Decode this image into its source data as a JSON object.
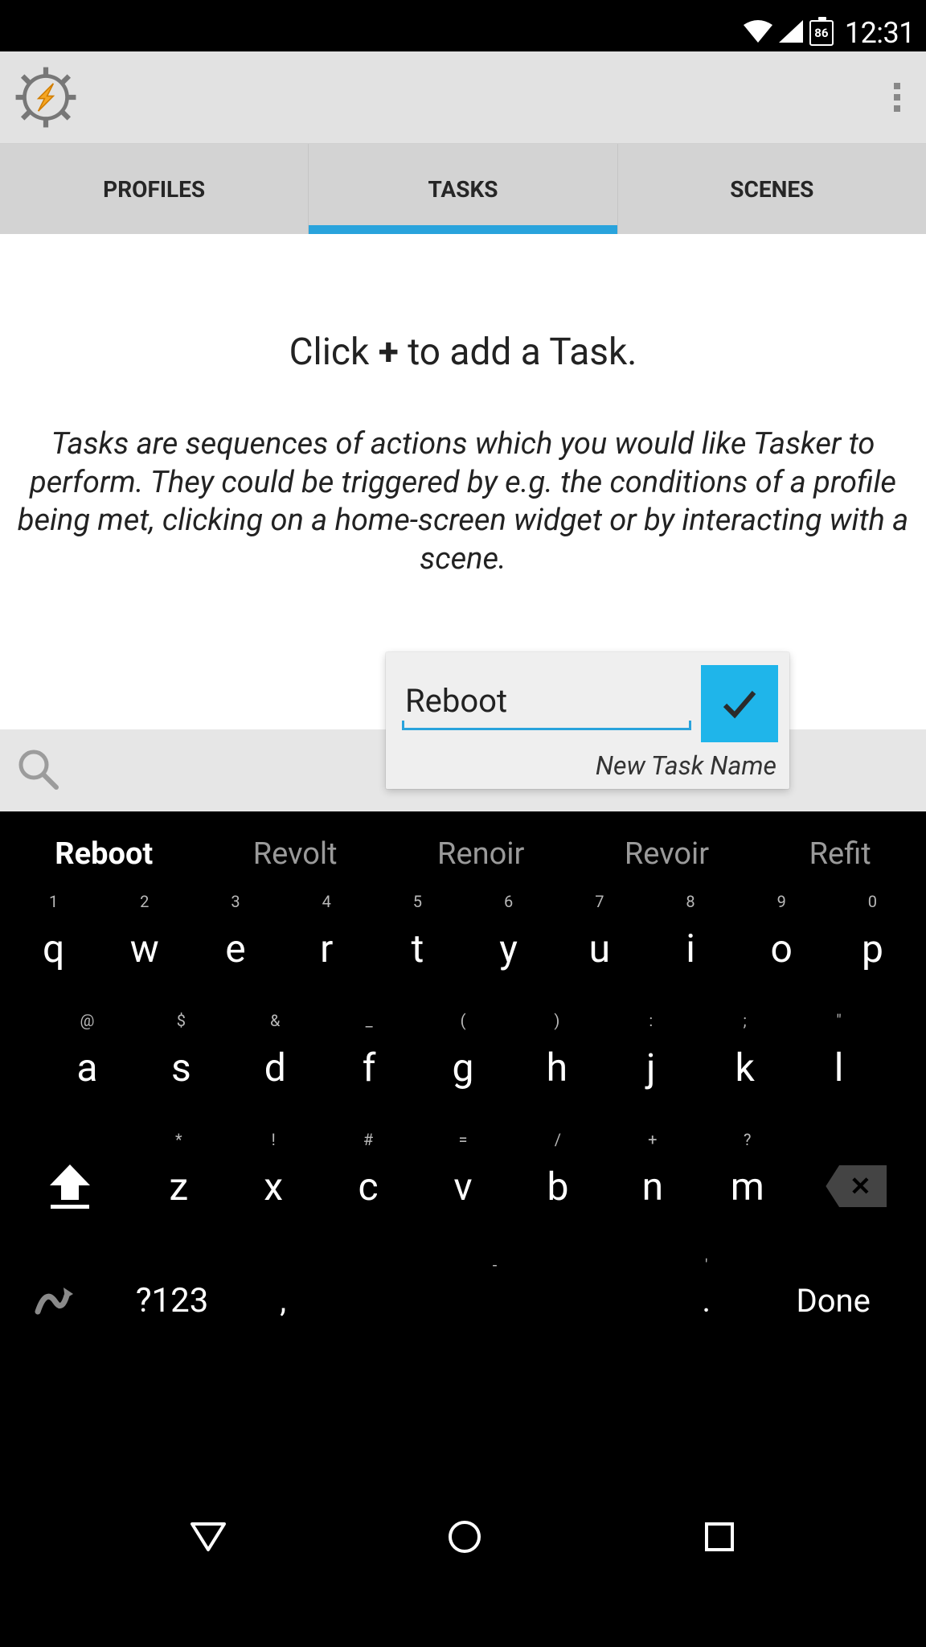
{
  "status": {
    "battery": "86",
    "clock": "12:31"
  },
  "tabs": [
    "PROFILES",
    "TASKS",
    "SCENES"
  ],
  "active_tab": 1,
  "content": {
    "headline_pre": "Click ",
    "headline_plus": "+",
    "headline_post": " to add a Task.",
    "body": "Tasks are sequences of actions which you would like Tasker to perform. They could be triggered by e.g. the conditions of a profile being met, clicking on a home-screen widget or by interacting with a scene."
  },
  "popup": {
    "value": "Reboot",
    "caption": "New Task Name"
  },
  "keyboard": {
    "suggestions": [
      "Reboot",
      "Revolt",
      "Renoir",
      "Revoir",
      "Refit"
    ],
    "row1": [
      {
        "k": "q",
        "h": "1"
      },
      {
        "k": "w",
        "h": "2"
      },
      {
        "k": "e",
        "h": "3"
      },
      {
        "k": "r",
        "h": "4"
      },
      {
        "k": "t",
        "h": "5"
      },
      {
        "k": "y",
        "h": "6"
      },
      {
        "k": "u",
        "h": "7"
      },
      {
        "k": "i",
        "h": "8"
      },
      {
        "k": "o",
        "h": "9"
      },
      {
        "k": "p",
        "h": "0"
      }
    ],
    "row2": [
      {
        "k": "a",
        "h": "@"
      },
      {
        "k": "s",
        "h": "$"
      },
      {
        "k": "d",
        "h": "&"
      },
      {
        "k": "f",
        "h": "_"
      },
      {
        "k": "g",
        "h": "("
      },
      {
        "k": "h",
        "h": ")"
      },
      {
        "k": "j",
        "h": ":"
      },
      {
        "k": "k",
        "h": ";"
      },
      {
        "k": "l",
        "h": "\""
      }
    ],
    "row3": [
      {
        "k": "z",
        "h": "*"
      },
      {
        "k": "x",
        "h": "!"
      },
      {
        "k": "c",
        "h": "#"
      },
      {
        "k": "v",
        "h": "="
      },
      {
        "k": "b",
        "h": "/"
      },
      {
        "k": "n",
        "h": "+"
      },
      {
        "k": "m",
        "h": "?"
      }
    ],
    "numtoggle": "?123",
    "space_hint": "-",
    "period_hint": "'",
    "done": "Done",
    "comma": ",",
    "period": "."
  }
}
